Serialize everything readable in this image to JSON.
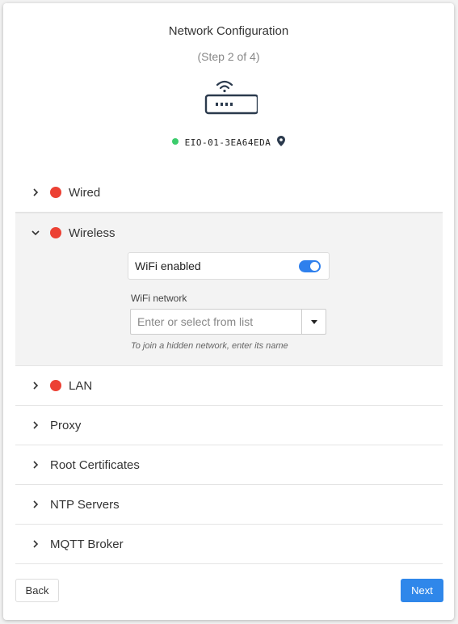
{
  "header": {
    "title": "Network Configuration",
    "step": "(Step 2 of 4)"
  },
  "device": {
    "icon": "router-icon",
    "status_color": "#3ccc6c",
    "name": "EIO-01-3EA64EDA",
    "location_icon": "map-pin-icon"
  },
  "sections": [
    {
      "label": "Wired",
      "expanded": false,
      "status": "error"
    },
    {
      "label": "Wireless",
      "expanded": true,
      "status": "error"
    },
    {
      "label": "LAN",
      "expanded": false,
      "status": "error"
    },
    {
      "label": "Proxy",
      "expanded": false
    },
    {
      "label": "Root Certificates",
      "expanded": false
    },
    {
      "label": "NTP Servers",
      "expanded": false
    },
    {
      "label": "MQTT Broker",
      "expanded": false
    }
  ],
  "wireless": {
    "wifi_enabled_label": "WiFi enabled",
    "wifi_enabled": true,
    "network_label": "WiFi network",
    "network_placeholder": "Enter or select from list",
    "network_value": "",
    "hint": "To join a hidden network, enter its name"
  },
  "footer": {
    "back_label": "Back",
    "next_label": "Next"
  },
  "colors": {
    "accent": "#2f87ea",
    "error": "#ec4134",
    "ok": "#3ccc6c"
  }
}
